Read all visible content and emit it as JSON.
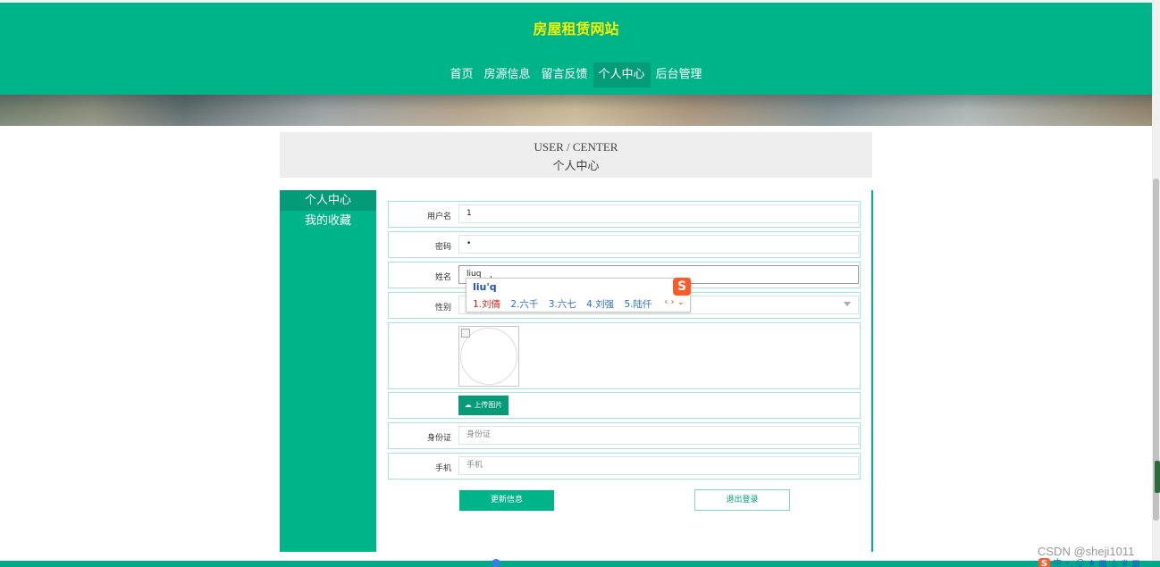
{
  "site": {
    "title": "房屋租赁网站"
  },
  "nav": {
    "items": [
      {
        "label": "首页"
      },
      {
        "label": "房源信息"
      },
      {
        "label": "留言反馈"
      },
      {
        "label": "个人中心",
        "active": true
      },
      {
        "label": "后台管理"
      }
    ]
  },
  "header": {
    "en": "USER / CENTER",
    "cn": "个人中心"
  },
  "sidebar": {
    "items": [
      {
        "label": "个人中心",
        "active": true
      },
      {
        "label": "我的收藏"
      }
    ]
  },
  "form": {
    "username": {
      "label": "用户名",
      "value": "1"
    },
    "password": {
      "label": "密码",
      "value": "•"
    },
    "name": {
      "label": "姓名",
      "value": "liuq"
    },
    "gender": {
      "label": "性别",
      "value": ""
    },
    "upload": {
      "label": "上传图片"
    },
    "idcard": {
      "label": "身份证",
      "placeholder": "身份证"
    },
    "phone": {
      "label": "手机",
      "placeholder": "手机"
    }
  },
  "buttons": {
    "update": "更新信息",
    "logout": "退出登录"
  },
  "ime": {
    "pinyin": "liu'q",
    "candidates": [
      "1.刘倩",
      "2.六千",
      "3.六七",
      "4.刘强",
      "5.陆仟"
    ],
    "arrows": "‹ › ⌄",
    "logo": "S"
  },
  "watermark": "CSDN @sheji1011",
  "tray": {
    "text": "中 •, ☺ ♦ ▦ ♙ ♛ ▦"
  },
  "colors": {
    "primary": "#00b48a",
    "active": "#049b78",
    "title": "#f4f100"
  }
}
